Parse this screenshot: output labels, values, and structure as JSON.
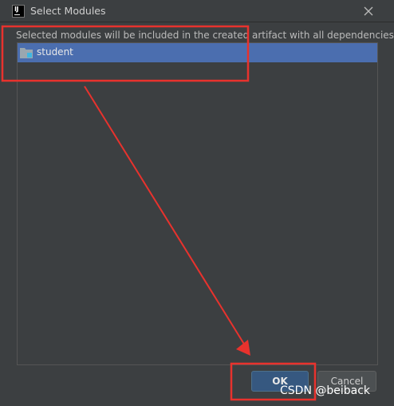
{
  "window": {
    "title": "Select Modules",
    "app_icon_text": "IJ"
  },
  "description": "Selected modules will be included in the created artifact with all dependencies",
  "modules": [
    {
      "name": "student",
      "icon": "module-folder-icon",
      "selected": true
    }
  ],
  "buttons": {
    "ok_label": "OK",
    "cancel_label": "Cancel"
  },
  "watermark": "CSDN @beiback",
  "colors": {
    "background": "#3c3f41",
    "selection": "#4b6eaf",
    "ok_button": "#365880",
    "annotation_red": "#e8322d"
  }
}
